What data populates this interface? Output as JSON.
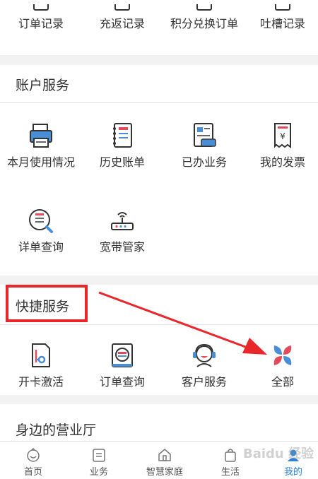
{
  "top_items": [
    "订单记录",
    "充返记录",
    "积分兑换订单",
    "吐槽记录"
  ],
  "account": {
    "title": "账户服务",
    "items": [
      "本月使用情况",
      "历史账单",
      "已办业务",
      "我的发票",
      "详单查询",
      "宽带管家"
    ]
  },
  "quick": {
    "title": "快捷服务",
    "items": [
      "开卡激活",
      "订单查询",
      "客户服务",
      "全部"
    ]
  },
  "nearby": {
    "title": "身边的营业厅"
  },
  "tabs": [
    "首页",
    "业务",
    "智慧家庭",
    "生活",
    "我的"
  ],
  "active_tab": "我的",
  "colors": {
    "accent": "#2b82d8",
    "icon_blue": "#4a8fd6",
    "icon_red": "#e34a5a",
    "annotation_red": "#e8262b"
  },
  "watermark": "Baidu 经验"
}
